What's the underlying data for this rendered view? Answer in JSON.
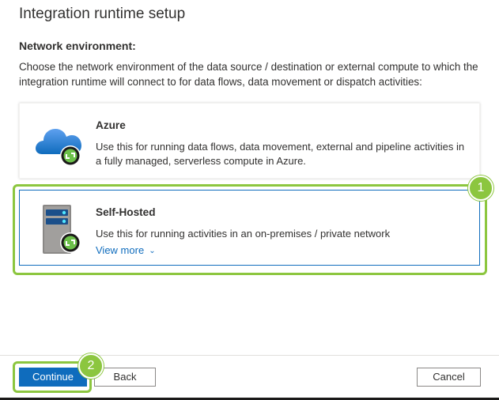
{
  "dialog": {
    "title": "Integration runtime setup",
    "section_label": "Network environment:",
    "description": "Choose the network environment of the data source / destination or external compute to which the integration runtime will connect to for data flows, data movement or dispatch activities:"
  },
  "options": [
    {
      "title": "Azure",
      "description": "Use this for running data flows, data movement, external and pipeline activities in a fully managed, serverless compute in Azure.",
      "icon": "azure-cloud-icon"
    },
    {
      "title": "Self-Hosted",
      "description": "Use this for running activities in an on-premises / private network",
      "view_more": "View more",
      "icon": "server-icon",
      "selected": true
    }
  ],
  "callouts": {
    "step1": "1",
    "step2": "2"
  },
  "footer": {
    "continue": "Continue",
    "back": "Back",
    "cancel": "Cancel"
  },
  "colors": {
    "accent": "#0f6cbd",
    "highlight": "#8cc63f"
  }
}
